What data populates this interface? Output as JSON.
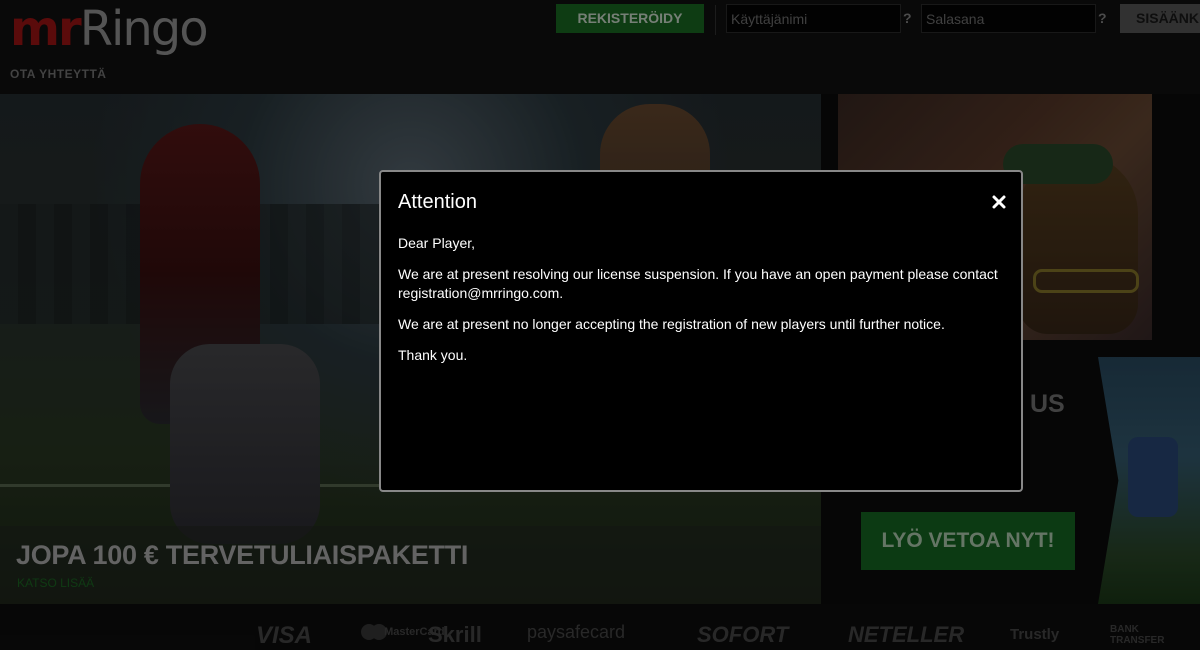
{
  "header": {
    "logo_mr": "mr",
    "logo_ringo": "Ringo",
    "contact_link": "OTA YHTEYTTÄ",
    "register_label": "REKISTERÖIDY",
    "username_placeholder": "Käyttäjänimi",
    "password_placeholder": "Salasana",
    "help_mark": "?",
    "login_label": "SISÄÄNK"
  },
  "banner": {
    "title": "JOPA 100 € TERVETULIAISPAKETTI",
    "link": "KATSO LISÄÄ"
  },
  "side": {
    "partial_text": "US",
    "bet_button": "LYÖ VETOA NYT!"
  },
  "footer": {
    "payments": [
      "VISA",
      "MasterCard",
      "Skrill",
      "paysafecard",
      "SOFORT",
      "NETELLER",
      "Trustly",
      "BANK",
      "TRANSFER"
    ]
  },
  "modal": {
    "title": "Attention",
    "close_icon": "close-icon",
    "greeting": "Dear Player,",
    "paragraph1": "We are at present resolving our license suspension. If you have an open payment please contact registration@mrringo.com.",
    "paragraph2": "We are at present no longer accepting the registration of new players until further notice.",
    "closing": "Thank you."
  },
  "colors": {
    "brand_red": "#a41414",
    "brand_green": "#1a6e24"
  }
}
